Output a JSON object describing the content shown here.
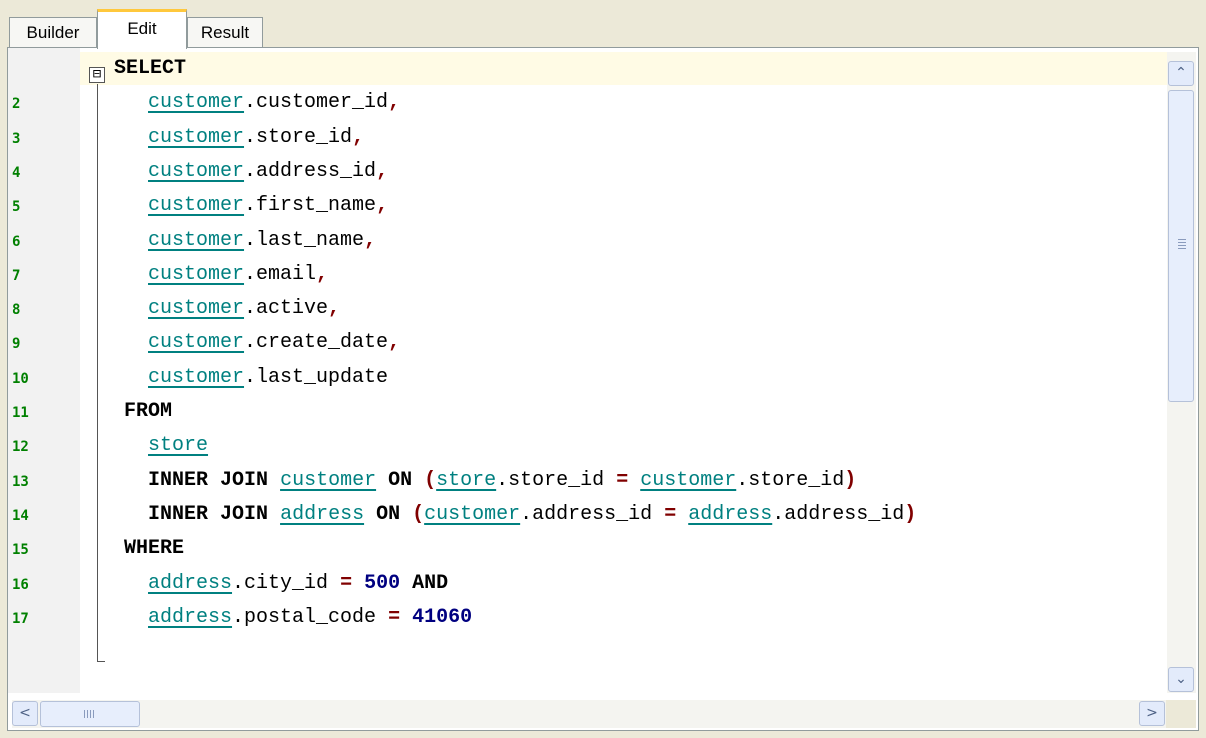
{
  "tabs": [
    {
      "label": "Builder",
      "active": false
    },
    {
      "label": "Edit",
      "active": true
    },
    {
      "label": "Result",
      "active": false
    }
  ],
  "editor": {
    "fold_marker": "⊟",
    "line_numbers": [
      "2",
      "3",
      "4",
      "5",
      "6",
      "7",
      "8",
      "9",
      "10",
      "11",
      "12",
      "13",
      "14",
      "15",
      "16",
      "17"
    ],
    "lines": [
      [
        {
          "t": "SELECT",
          "c": "kw"
        }
      ],
      [
        {
          "t": "  "
        },
        {
          "t": "customer",
          "c": "tbl"
        },
        {
          "t": ".customer_id"
        },
        {
          "t": ",",
          "c": "punc"
        }
      ],
      [
        {
          "t": "  "
        },
        {
          "t": "customer",
          "c": "tbl"
        },
        {
          "t": ".store_id"
        },
        {
          "t": ",",
          "c": "punc"
        }
      ],
      [
        {
          "t": "  "
        },
        {
          "t": "customer",
          "c": "tbl"
        },
        {
          "t": ".address_id"
        },
        {
          "t": ",",
          "c": "punc"
        }
      ],
      [
        {
          "t": "  "
        },
        {
          "t": "customer",
          "c": "tbl"
        },
        {
          "t": ".first_name"
        },
        {
          "t": ",",
          "c": "punc"
        }
      ],
      [
        {
          "t": "  "
        },
        {
          "t": "customer",
          "c": "tbl"
        },
        {
          "t": ".last_name"
        },
        {
          "t": ",",
          "c": "punc"
        }
      ],
      [
        {
          "t": "  "
        },
        {
          "t": "customer",
          "c": "tbl"
        },
        {
          "t": ".email"
        },
        {
          "t": ",",
          "c": "punc"
        }
      ],
      [
        {
          "t": "  "
        },
        {
          "t": "customer",
          "c": "tbl"
        },
        {
          "t": ".active"
        },
        {
          "t": ",",
          "c": "punc"
        }
      ],
      [
        {
          "t": "  "
        },
        {
          "t": "customer",
          "c": "tbl"
        },
        {
          "t": ".create_date"
        },
        {
          "t": ",",
          "c": "punc"
        }
      ],
      [
        {
          "t": "  "
        },
        {
          "t": "customer",
          "c": "tbl"
        },
        {
          "t": ".last_update"
        }
      ],
      [
        {
          "t": "FROM",
          "c": "kw"
        }
      ],
      [
        {
          "t": "  "
        },
        {
          "t": "store",
          "c": "tbl"
        }
      ],
      [
        {
          "t": "  "
        },
        {
          "t": "INNER JOIN",
          "c": "kw"
        },
        {
          "t": " "
        },
        {
          "t": "customer",
          "c": "tbl"
        },
        {
          "t": " "
        },
        {
          "t": "ON",
          "c": "kw"
        },
        {
          "t": " "
        },
        {
          "t": "(",
          "c": "punc"
        },
        {
          "t": "store",
          "c": "tbl"
        },
        {
          "t": ".store_id "
        },
        {
          "t": "=",
          "c": "punc"
        },
        {
          "t": " "
        },
        {
          "t": "customer",
          "c": "tbl"
        },
        {
          "t": ".store_id"
        },
        {
          "t": ")",
          "c": "punc"
        }
      ],
      [
        {
          "t": "  "
        },
        {
          "t": "INNER JOIN",
          "c": "kw"
        },
        {
          "t": " "
        },
        {
          "t": "address",
          "c": "tbl"
        },
        {
          "t": " "
        },
        {
          "t": "ON",
          "c": "kw"
        },
        {
          "t": " "
        },
        {
          "t": "(",
          "c": "punc"
        },
        {
          "t": "customer",
          "c": "tbl"
        },
        {
          "t": ".address_id "
        },
        {
          "t": "=",
          "c": "punc"
        },
        {
          "t": " "
        },
        {
          "t": "address",
          "c": "tbl"
        },
        {
          "t": ".address_id"
        },
        {
          "t": ")",
          "c": "punc"
        }
      ],
      [
        {
          "t": "WHERE",
          "c": "kw"
        }
      ],
      [
        {
          "t": "  "
        },
        {
          "t": "address",
          "c": "tbl"
        },
        {
          "t": ".city_id "
        },
        {
          "t": "=",
          "c": "punc"
        },
        {
          "t": " "
        },
        {
          "t": "500",
          "c": "num"
        },
        {
          "t": " "
        },
        {
          "t": "AND",
          "c": "kw"
        }
      ],
      [
        {
          "t": "  "
        },
        {
          "t": "address",
          "c": "tbl"
        },
        {
          "t": ".postal_code "
        },
        {
          "t": "=",
          "c": "punc"
        },
        {
          "t": " "
        },
        {
          "t": "41060",
          "c": "num"
        }
      ]
    ]
  },
  "scrollbars": {
    "up_arrow": "⌃",
    "down_arrow": "⌄",
    "left_arrow": "<",
    "right_arrow": ">"
  }
}
